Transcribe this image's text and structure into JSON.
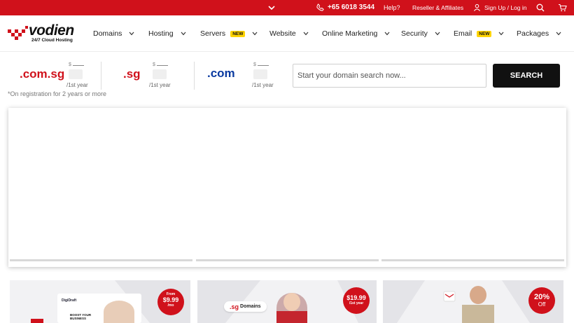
{
  "topbar": {
    "phone": "+65 6018 3544",
    "help": "Help?",
    "reseller": "Reseller & Affiliates",
    "signup": "Sign Up / Log in"
  },
  "brand": {
    "name": "vodien",
    "tagline": "24/7 Cloud Hosting"
  },
  "nav": {
    "items": [
      {
        "label": "Domains",
        "badge": ""
      },
      {
        "label": "Hosting",
        "badge": ""
      },
      {
        "label": "Servers",
        "badge": "NEW"
      },
      {
        "label": "Website",
        "badge": ""
      },
      {
        "label": "Online Marketing",
        "badge": ""
      },
      {
        "label": "Security",
        "badge": ""
      },
      {
        "label": "Email",
        "badge": "NEW"
      },
      {
        "label": "Packages",
        "badge": ""
      }
    ]
  },
  "domains": {
    "items": [
      {
        "ext": ".com.sg",
        "currency": "$",
        "per": "/1st year"
      },
      {
        "ext": ".sg",
        "currency": "$",
        "per": "/1st year"
      },
      {
        "ext": ".com",
        "currency": "$",
        "per": "/1st year"
      }
    ],
    "note": "*On registration for 2 years or more",
    "search_placeholder": "Start your domain search now...",
    "search_label": "SEARCH"
  },
  "promos": {
    "card1": {
      "from": "From",
      "price": "$9.99",
      "per": "/mo",
      "brand": "DigiDraft",
      "headline": "BOOST YOUR BUSINESS"
    },
    "card2": {
      "ext": ".sg",
      "label": "Domains",
      "price": "$19.99",
      "per": "/1st year"
    },
    "card3": {
      "percent": "20%",
      "off": "Off"
    }
  },
  "colors": {
    "brand_red": "#d0111b",
    "dark": "#111111",
    "badge_yellow": "#ffd400"
  }
}
